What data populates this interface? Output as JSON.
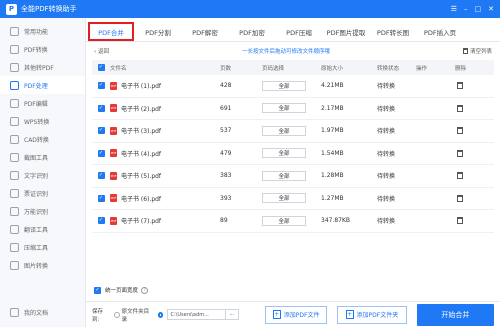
{
  "titlebar": {
    "title": "全能PDF转换助手",
    "logo_text": "P"
  },
  "sidebar": {
    "items": [
      {
        "label": "常用功能",
        "icon": "star-icon"
      },
      {
        "label": "PDF转换",
        "icon": "convert-icon"
      },
      {
        "label": "其他转PDF",
        "icon": "import-icon"
      },
      {
        "label": "PDF处理",
        "icon": "process-icon",
        "active": true
      },
      {
        "label": "PDF编辑",
        "icon": "edit-icon"
      },
      {
        "label": "WPS转换",
        "icon": "wps-icon"
      },
      {
        "label": "CAD转换",
        "icon": "cad-icon"
      },
      {
        "label": "截图工具",
        "icon": "scissors-icon"
      },
      {
        "label": "文字识别",
        "icon": "ocr-icon"
      },
      {
        "label": "票证识别",
        "icon": "ticket-icon"
      },
      {
        "label": "万能识别",
        "icon": "scan-icon"
      },
      {
        "label": "翻译工具",
        "icon": "translate-icon"
      },
      {
        "label": "压缩工具",
        "icon": "compress-icon"
      },
      {
        "label": "图片转换",
        "icon": "image-icon"
      }
    ],
    "bottom": {
      "label": "我的文档",
      "icon": "folder-icon"
    }
  },
  "tabs": [
    "PDF合并",
    "PDF分割",
    "PDF解密",
    "PDF加密",
    "PDF压缩",
    "PDF图片提取",
    "PDF转长图",
    "PDF插入页"
  ],
  "toolbar": {
    "back": "返回",
    "hint": "一长按文件后拖动可修改文件顺序哦",
    "clear": "清空列表"
  },
  "table": {
    "headers": {
      "name": "文件名",
      "pages": "页数",
      "range": "页码选择",
      "size": "原始大小",
      "status": "转换状态",
      "op": "操作",
      "del": "删除"
    },
    "rows": [
      {
        "name": "电子书 (1).pdf",
        "pages": "428",
        "range": "全部",
        "size": "4.21MB",
        "status": "待转换"
      },
      {
        "name": "电子书 (2).pdf",
        "pages": "691",
        "range": "全部",
        "size": "2.17MB",
        "status": "待转换"
      },
      {
        "name": "电子书 (3).pdf",
        "pages": "537",
        "range": "全部",
        "size": "1.97MB",
        "status": "待转换"
      },
      {
        "name": "电子书 (4).pdf",
        "pages": "479",
        "range": "全部",
        "size": "1.54MB",
        "status": "待转换"
      },
      {
        "name": "电子书 (5).pdf",
        "pages": "383",
        "range": "全部",
        "size": "1.28MB",
        "status": "待转换"
      },
      {
        "name": "电子书 (6).pdf",
        "pages": "393",
        "range": "全部",
        "size": "1.27MB",
        "status": "待转换"
      },
      {
        "name": "电子书 (7).pdf",
        "pages": "89",
        "range": "全部",
        "size": "347.87KB",
        "status": "待转换"
      }
    ]
  },
  "unify": {
    "label": "统一页面宽度"
  },
  "bottom": {
    "save_to": "保存到:",
    "opt_source": "原文件夹目录",
    "path_value": "C:\\Users\\adm...",
    "dots": "···",
    "add_file": "添加PDF文件",
    "add_folder": "添加PDF文件夹",
    "start": "开始合并"
  }
}
